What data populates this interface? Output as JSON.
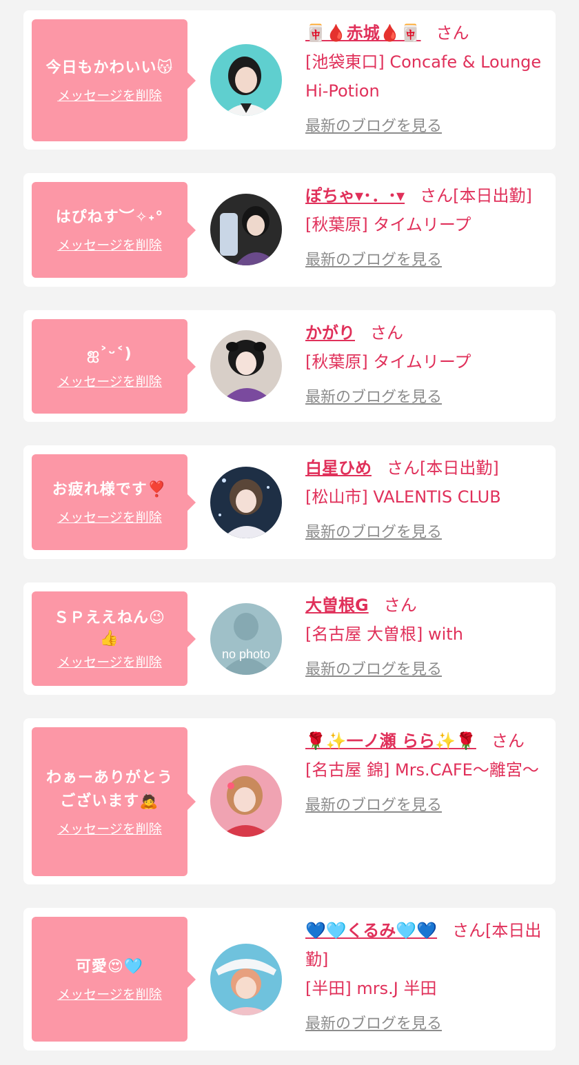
{
  "colors": {
    "accent": "#e0305a",
    "bubble": "#fc97a6",
    "link_gray": "#8c8c8c",
    "background": "#f3f3f3"
  },
  "delete_label": "メッセージを削除",
  "blog_label": "最新のブログを見る",
  "cards": [
    {
      "message_lines": [
        "今日もかわいい😽"
      ],
      "name": "🀄🩸赤城🩸🀄",
      "suffix": "さん",
      "store": "[池袋東口] Concafe & Lounge Hi-Potion",
      "avatar": "avatar-photo"
    },
    {
      "message_lines": [
        "はぴねす︶✧˖°"
      ],
      "name": "ぽちゃ▾･．･▾",
      "suffix": "さん[本日出勤]",
      "store": "[秋葉原] タイムリープ",
      "avatar": "avatar-photo"
    },
    {
      "message_lines": [
        "ஐ˃ᵕ˂)"
      ],
      "name": "かがり",
      "suffix": "さん",
      "store": "[秋葉原] タイムリープ",
      "avatar": "avatar-photo"
    },
    {
      "message_lines": [
        "お疲れ様です❣️"
      ],
      "name": "白星ひめ",
      "suffix": "さん[本日出勤]",
      "store": "[松山市] VALENTIS CLUB",
      "avatar": "avatar-photo"
    },
    {
      "message_lines": [
        "ＳＰええねん😉",
        "👍"
      ],
      "name": "大曽根G",
      "suffix": "さん",
      "store": "[名古屋 大曽根] with",
      "avatar": "no-photo-avatar",
      "avatar_text": "no photo"
    },
    {
      "message_lines": [
        "わぁーありがとう",
        "ございます🙇"
      ],
      "name": "🌹✨一ノ瀬 らら✨🌹",
      "suffix": "さん",
      "store": "[名古屋 錦] Mrs.CAFE〜離宮〜",
      "avatar": "avatar-photo"
    },
    {
      "message_lines": [
        "可愛😍🩵"
      ],
      "name": "💙🩵くるみ🩵💙",
      "suffix": "さん[本日出勤]",
      "store": "[半田] mrs.J 半田",
      "avatar": "avatar-photo"
    }
  ]
}
